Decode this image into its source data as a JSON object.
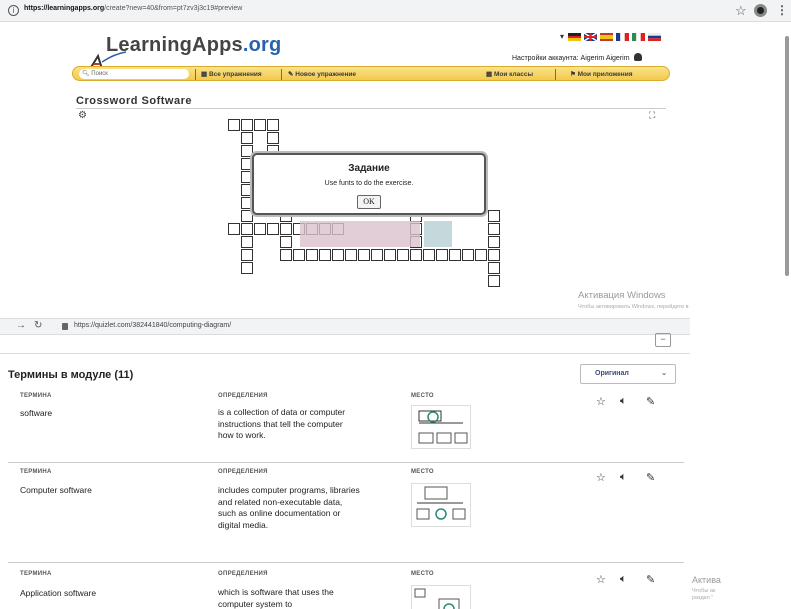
{
  "top_window": {
    "url_bold": "https://learningapps.org",
    "url_rest": "/create?new=40&from=pt7zv3j3c19#preview",
    "logo_text": "LearningApps",
    "logo_tld": ".org",
    "account_text": "Настройки аккаунта: Aigerim Aigerim",
    "search_placeholder": "Поиск",
    "nav": {
      "all_exercises": "Все упражнения",
      "new_exercise": "Новое упражнение",
      "my_classes": "Мои классы",
      "my_apps": "Мои приложения"
    },
    "app_title": "Crossword Software",
    "dialog": {
      "title": "Задание",
      "text": "Use funts to do the exercise.",
      "ok": "OK"
    },
    "windows_activation": "Активация Windows",
    "windows_activation_sub": "Чтобы активировать Windows, перейдите в"
  },
  "bottom_window": {
    "url": "https://quizlet.com/382441840/computing-diagram/",
    "heading": "Термины в модуле (11)",
    "sort_select": "Оригинал",
    "col_term": "ТЕРМИНА",
    "col_def": "ОПРЕДЕЛЕНИЯ",
    "col_place": "МЕСТО",
    "cards": [
      {
        "term": "software",
        "definition": "is a collection of data or computer instructions that tell the computer how to work."
      },
      {
        "term": "Computer software",
        "definition": "includes computer programs, libraries and related non-executable data, such as online documentation or digital media."
      },
      {
        "term": "Application software",
        "definition": "which is software that uses the computer system to"
      }
    ],
    "windows_activation": "Актива",
    "windows_activation_sub1": "Чтобы ак",
    "windows_activation_sub2": "раздел \""
  },
  "colors": {
    "navbar_yellow": "#f2c94c",
    "logo_blue": "#2a62a8",
    "quizlet_select_text": "#3a4a7a"
  }
}
